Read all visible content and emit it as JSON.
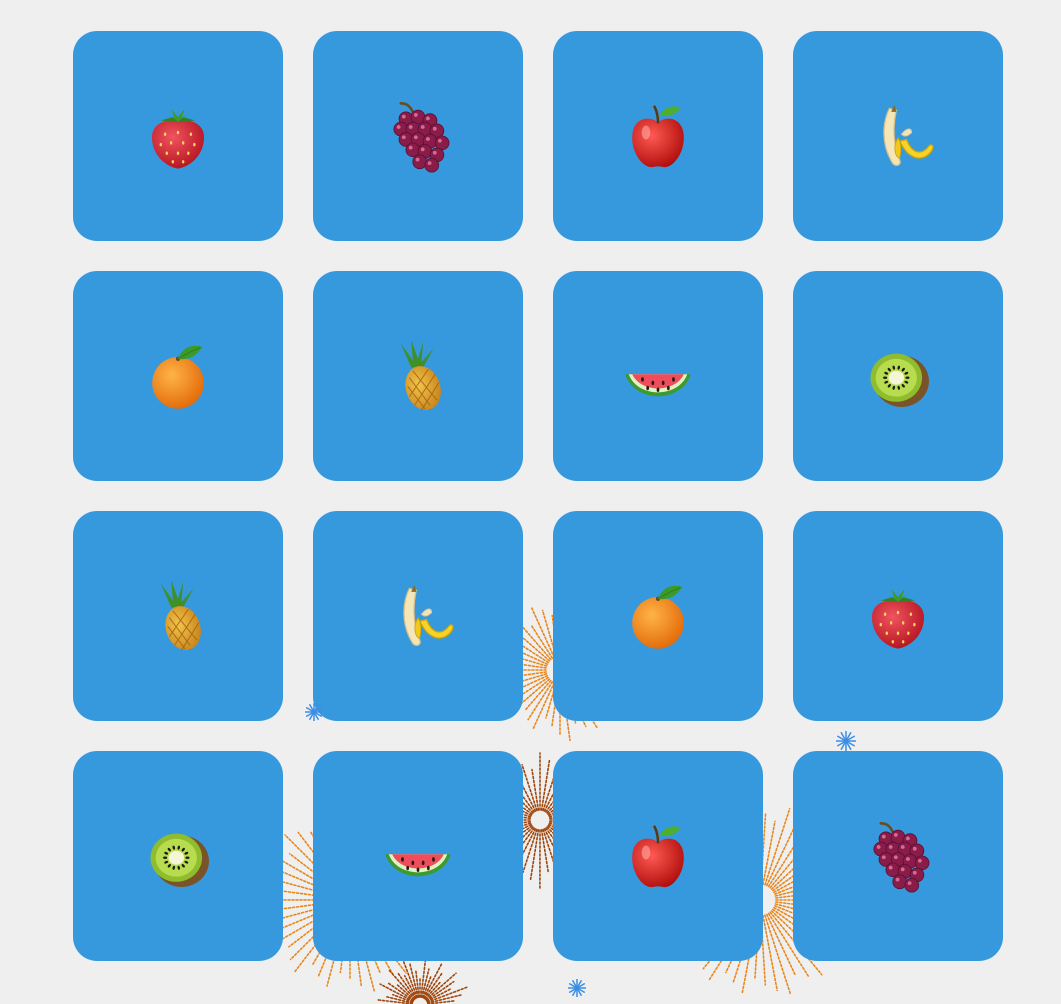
{
  "board": {
    "columns": 4,
    "card_color": "#3799dd",
    "background_color": "#efefef",
    "cards": [
      {
        "fruit": "strawberry",
        "icon": "strawberry-icon"
      },
      {
        "fruit": "grapes",
        "icon": "grapes-icon"
      },
      {
        "fruit": "apple",
        "icon": "apple-icon"
      },
      {
        "fruit": "banana",
        "icon": "banana-icon"
      },
      {
        "fruit": "orange",
        "icon": "orange-icon"
      },
      {
        "fruit": "pineapple",
        "icon": "pineapple-icon"
      },
      {
        "fruit": "watermelon",
        "icon": "watermelon-icon"
      },
      {
        "fruit": "kiwi",
        "icon": "kiwi-icon"
      },
      {
        "fruit": "pineapple",
        "icon": "pineapple-icon"
      },
      {
        "fruit": "banana",
        "icon": "banana-icon"
      },
      {
        "fruit": "orange",
        "icon": "orange-icon"
      },
      {
        "fruit": "strawberry",
        "icon": "strawberry-icon"
      },
      {
        "fruit": "kiwi",
        "icon": "kiwi-icon"
      },
      {
        "fruit": "watermelon",
        "icon": "watermelon-icon"
      },
      {
        "fruit": "apple",
        "icon": "apple-icon"
      },
      {
        "fruit": "grapes",
        "icon": "grapes-icon"
      }
    ]
  },
  "effects": {
    "firework_colors": [
      "#e8871e",
      "#a0450c"
    ],
    "sparkle_color": "#3a8ee6"
  }
}
